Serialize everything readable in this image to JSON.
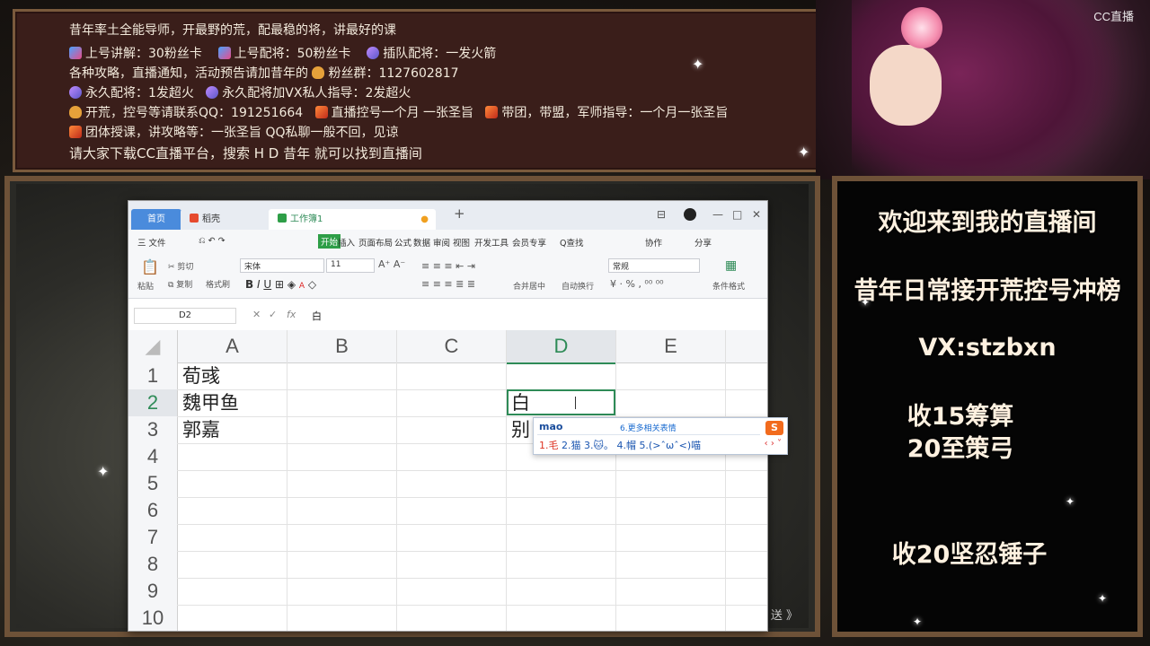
{
  "top_banner": {
    "line1": "昔年率土全能导师，开最野的荒，配最稳的将，讲最好的课",
    "line2a": "上号讲解：30粉丝卡",
    "line2b": "上号配将：50粉丝卡",
    "line2c": "插队配将：一发火箭",
    "line3": "各种攻略，直播通知，活动预告请加昔年的",
    "line3b": "粉丝群：1127602817",
    "line4a": "永久配将：1发超火",
    "line4b": "永久配将加VX私人指导：2发超火",
    "line5a": "开荒，控号等请联系QQ：191251664",
    "line5b": "直播控号一个月 一张圣旨",
    "line5c": "带团，带盟，军师指导：一个月一张圣旨",
    "line6": "团体授课，讲攻略等：一张圣旨    QQ私聊一般不回，见谅",
    "line7": "请大家下载CC直播平台，搜索 H D  昔年    就可以找到直播间"
  },
  "logo": "CC直播",
  "right_panel": {
    "welcome": "欢迎来到我的直播间",
    "service": "昔年日常接开荒控号冲榜",
    "vx": "VX:stzbxn",
    "buy1": "收15筹算",
    "buy2": "20至策弓",
    "buy3": "收20坚忍锤子"
  },
  "wps": {
    "tabs": {
      "home": "首页",
      "dh": "稻壳",
      "wb": "工作簿1"
    },
    "menu": {
      "file": "三 文件",
      "start": "开始",
      "insert": "插入",
      "layout": "页面布局",
      "formula": "公式",
      "data": "数据",
      "review": "审阅",
      "view": "视图",
      "dev": "开发工具",
      "vip": "会员专享",
      "search": "Q查找",
      "collab": "协作",
      "share": "分享"
    },
    "ribbon": {
      "cut": "剪切",
      "copy": "复制",
      "paste": "粘贴",
      "fmt": "格式刷",
      "font": "宋体",
      "size": "11",
      "merge": "合并居中",
      "wrap": "自动换行",
      "numfmt": "常规",
      "cond": "条件格式"
    },
    "namebox": "D2",
    "formula_value": "白",
    "columns": [
      "A",
      "B",
      "C",
      "D",
      "E"
    ],
    "rows": [
      "1",
      "2",
      "3",
      "4",
      "5",
      "6",
      "7",
      "8",
      "9",
      "10"
    ],
    "cells": {
      "A1": "荀彧",
      "A2": "魏甲鱼",
      "A3": "郭嘉",
      "D2": "白",
      "D3": "别"
    }
  },
  "ime": {
    "pinyin": "mao",
    "more": "6.更多相关表情",
    "candidates": "1.毛  2.猫  3.🐱。 4.帽  5.(>ˆωˆ<)喵",
    "first": "1.毛",
    "rest": "  2.猫  3.🐱。 4.帽  5.(>ˆωˆ<)喵",
    "brand": "S",
    "nav": "‹ › ˅"
  },
  "desk_send": "送 》"
}
